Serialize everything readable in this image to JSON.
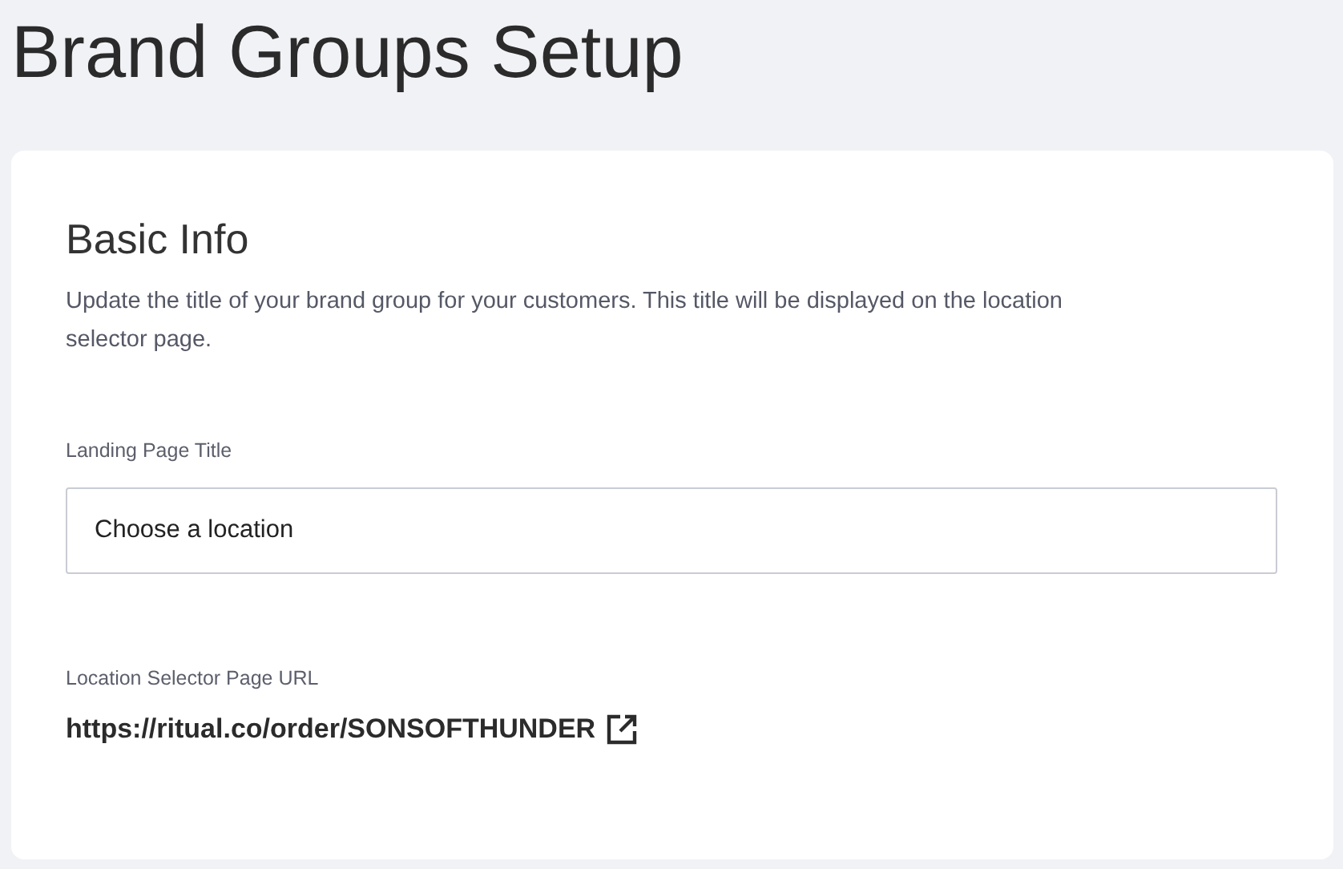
{
  "page_title": "Brand Groups Setup",
  "section": {
    "title": "Basic Info",
    "description": "Update the title of your brand group for your customers. This title will be displayed on the location selector page.",
    "landing_title_field": {
      "label": "Landing Page Title",
      "value": "Choose a location"
    },
    "url": {
      "label": "Location Selector Page URL",
      "value": "https://ritual.co/order/SONSOFTHUNDER"
    }
  }
}
